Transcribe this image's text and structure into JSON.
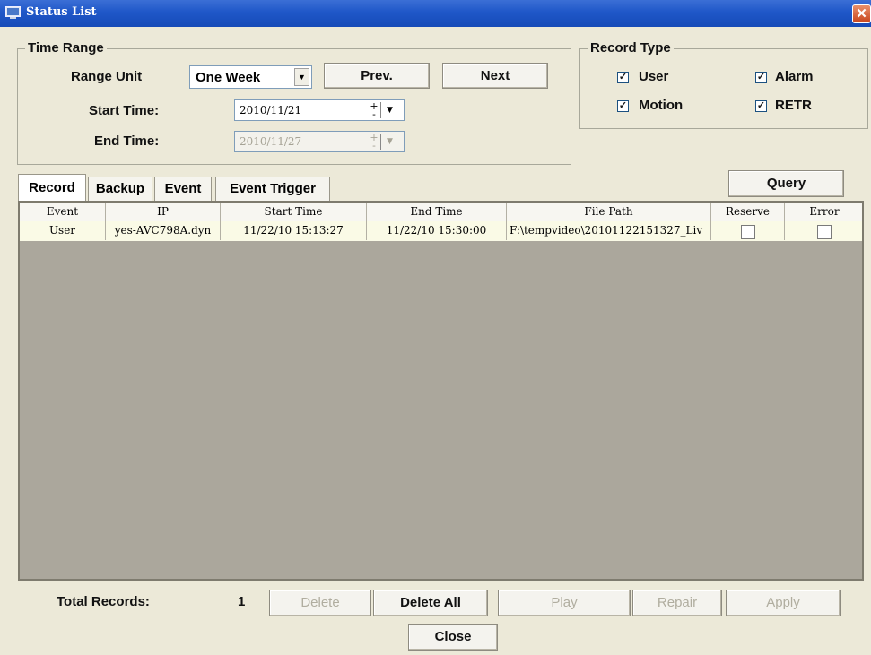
{
  "window": {
    "title": "Status List",
    "close_glyph": "✕"
  },
  "time_range": {
    "group_label": "Time Range",
    "range_unit_label": "Range Unit",
    "range_unit_value": "One Week",
    "prev_label": "Prev.",
    "next_label": "Next",
    "start_label": "Start Time:",
    "start_value": "2010/11/21",
    "end_label": "End Time:",
    "end_value": "2010/11/27"
  },
  "record_type": {
    "group_label": "Record Type",
    "options": [
      {
        "label": "User",
        "checked": true
      },
      {
        "label": "Alarm",
        "checked": true
      },
      {
        "label": "Motion",
        "checked": true
      },
      {
        "label": "RETR",
        "checked": true
      }
    ]
  },
  "tabs": [
    "Record",
    "Backup",
    "Event",
    "Event Trigger"
  ],
  "query_label": "Query",
  "table": {
    "columns": [
      "Event",
      "IP",
      "Start Time",
      "End Time",
      "File Path",
      "Reserve",
      "Error"
    ],
    "rows": [
      {
        "event": "User",
        "ip": "yes-AVC798A.dyn",
        "start": "11/22/10 15:13:27",
        "end": "11/22/10 15:30:00",
        "path": "F:\\tempvideo\\20101122151327_Liv",
        "reserve": false,
        "error": false
      }
    ]
  },
  "footer": {
    "total_label": "Total Records:",
    "total_value": "1",
    "delete_label": "Delete",
    "delete_all_label": "Delete All",
    "play_label": "Play",
    "repair_label": "Repair",
    "apply_label": "Apply",
    "close_label": "Close"
  },
  "icons": {
    "app": "monitor-icon",
    "dropdown": "chevron-down-icon",
    "check": "✓"
  }
}
